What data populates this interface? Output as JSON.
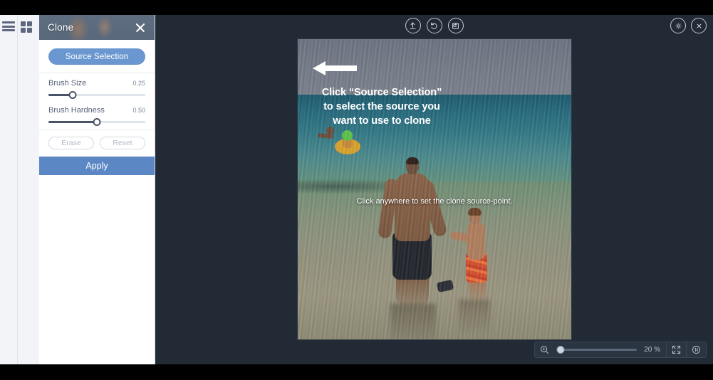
{
  "app": {
    "background_color": "#212a35",
    "panel_background": "#ffffff",
    "accent_color": "#5b87c4",
    "source_button_color": "#6b97d0"
  },
  "rail": {
    "items": [
      {
        "name": "menu-icon",
        "label": "Menu"
      },
      {
        "name": "grid-icon",
        "label": "Tools"
      }
    ]
  },
  "panel": {
    "title": "Clone",
    "close_label": "×",
    "source_selection_label": "Source Selection",
    "sliders": [
      {
        "label": "Brush Size",
        "value": "0.25",
        "percent": 25
      },
      {
        "label": "Brush Hardness",
        "value": "0.50",
        "percent": 50
      }
    ],
    "erase_label": "Erase",
    "reset_label": "Reset",
    "apply_label": "Apply"
  },
  "toolbar": {
    "upload_label": "Upload",
    "undo_label": "Undo",
    "save_label": "Save",
    "settings_label": "Settings",
    "close_label": "Close"
  },
  "canvas": {
    "hint": "Click anywhere to set the clone source-point.",
    "cursor": "clone-source-crosshair"
  },
  "zoom": {
    "magnifier_label": "Zoom",
    "percent": "20 %",
    "slider_percent": 3,
    "fit_label": "Fit to screen",
    "actual_size_label": "Actual size 1:1"
  },
  "annotation": {
    "arrow": "left-arrow",
    "line1": "Click “Source Selection”",
    "line2": "to select the source you",
    "line3": "want to use to clone"
  }
}
